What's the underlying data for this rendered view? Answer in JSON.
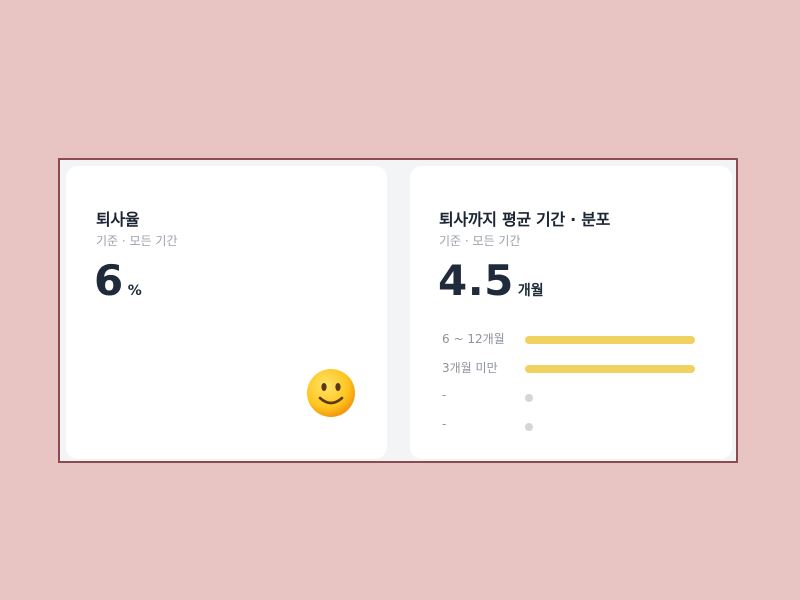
{
  "colors": {
    "accent_bar": "#f2d163",
    "empty_dot": "#d3d5d8",
    "page_background": "#e8c4c2"
  },
  "turnover_card": {
    "title": "퇴사율",
    "subtitle": "기준 · 모든 기간",
    "value": "6",
    "unit": "%",
    "emoji_icon": "slightly-smiling-face-icon"
  },
  "tenure_card": {
    "title": "퇴사까지 평균 기간 · 분포",
    "subtitle": "기준 · 모든 기간",
    "value": "4.5",
    "unit": "개월",
    "distribution": [
      {
        "label": "6 ~ 12개월",
        "fraction": 1.0
      },
      {
        "label": "3개월 미만",
        "fraction": 1.0
      },
      {
        "label": "-",
        "fraction": 0
      },
      {
        "label": "-",
        "fraction": 0
      }
    ]
  }
}
